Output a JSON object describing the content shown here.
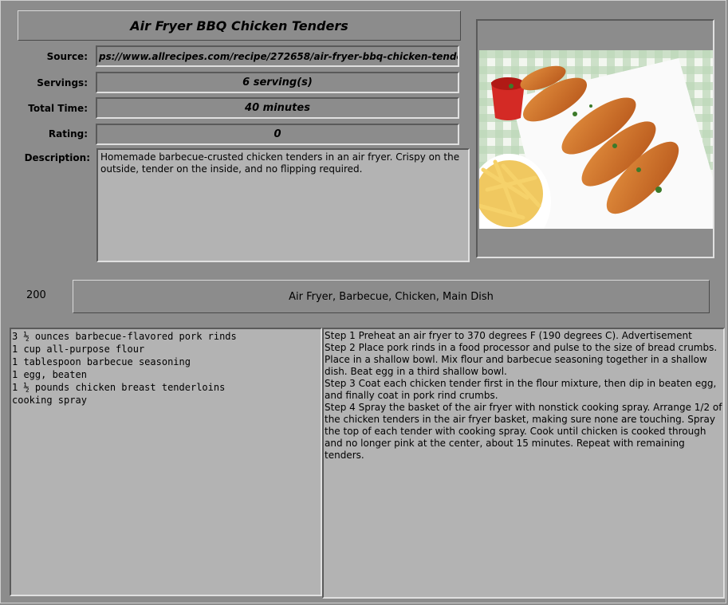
{
  "recipe": {
    "title": "Air Fryer BBQ Chicken Tenders",
    "source_label": "Source:",
    "source": "ps://www.allrecipes.com/recipe/272658/air-fryer-bbq-chicken-tende",
    "servings_label": "Servings:",
    "servings": "6 serving(s)",
    "total_time_label": "Total Time:",
    "total_time": "40 minutes",
    "rating_label": "Rating:",
    "rating": "0",
    "description_label": "Description:",
    "description": "Homemade barbecue-crusted chicken tenders in an air fryer. Crispy on the outside, tender on the inside, and no flipping required."
  },
  "count": "200",
  "tags": "Air Fryer, Barbecue, Chicken, Main Dish",
  "ingredients": [
    "3 ½ ounces barbecue-flavored pork rinds",
    "1 cup all-purpose flour",
    "1 tablespoon barbecue seasoning",
    "1 egg, beaten",
    "1 ½ pounds chicken breast tenderloins",
    "cooking spray"
  ],
  "directions": [
    "Step 1 Preheat an air fryer to 370 degrees F (190 degrees C). Advertisement",
    "Step 2 Place pork rinds in a food processor and pulse to the size of bread crumbs. Place in a shallow bowl. Mix flour and barbecue seasoning together in a shallow dish. Beat egg in a third shallow bowl.",
    "Step 3 Coat each chicken tender first in the flour mixture, then dip in beaten egg, and finally coat in pork rind crumbs.",
    "Step 4 Spray the basket of the air fryer with nonstick cooking spray. Arrange 1/2 of the chicken tenders in the air fryer basket, making sure none are touching. Spray the top of each tender with cooking spray. Cook until chicken is cooked through and no longer pink at the center, about 15 minutes. Repeat with remaining tenders."
  ]
}
